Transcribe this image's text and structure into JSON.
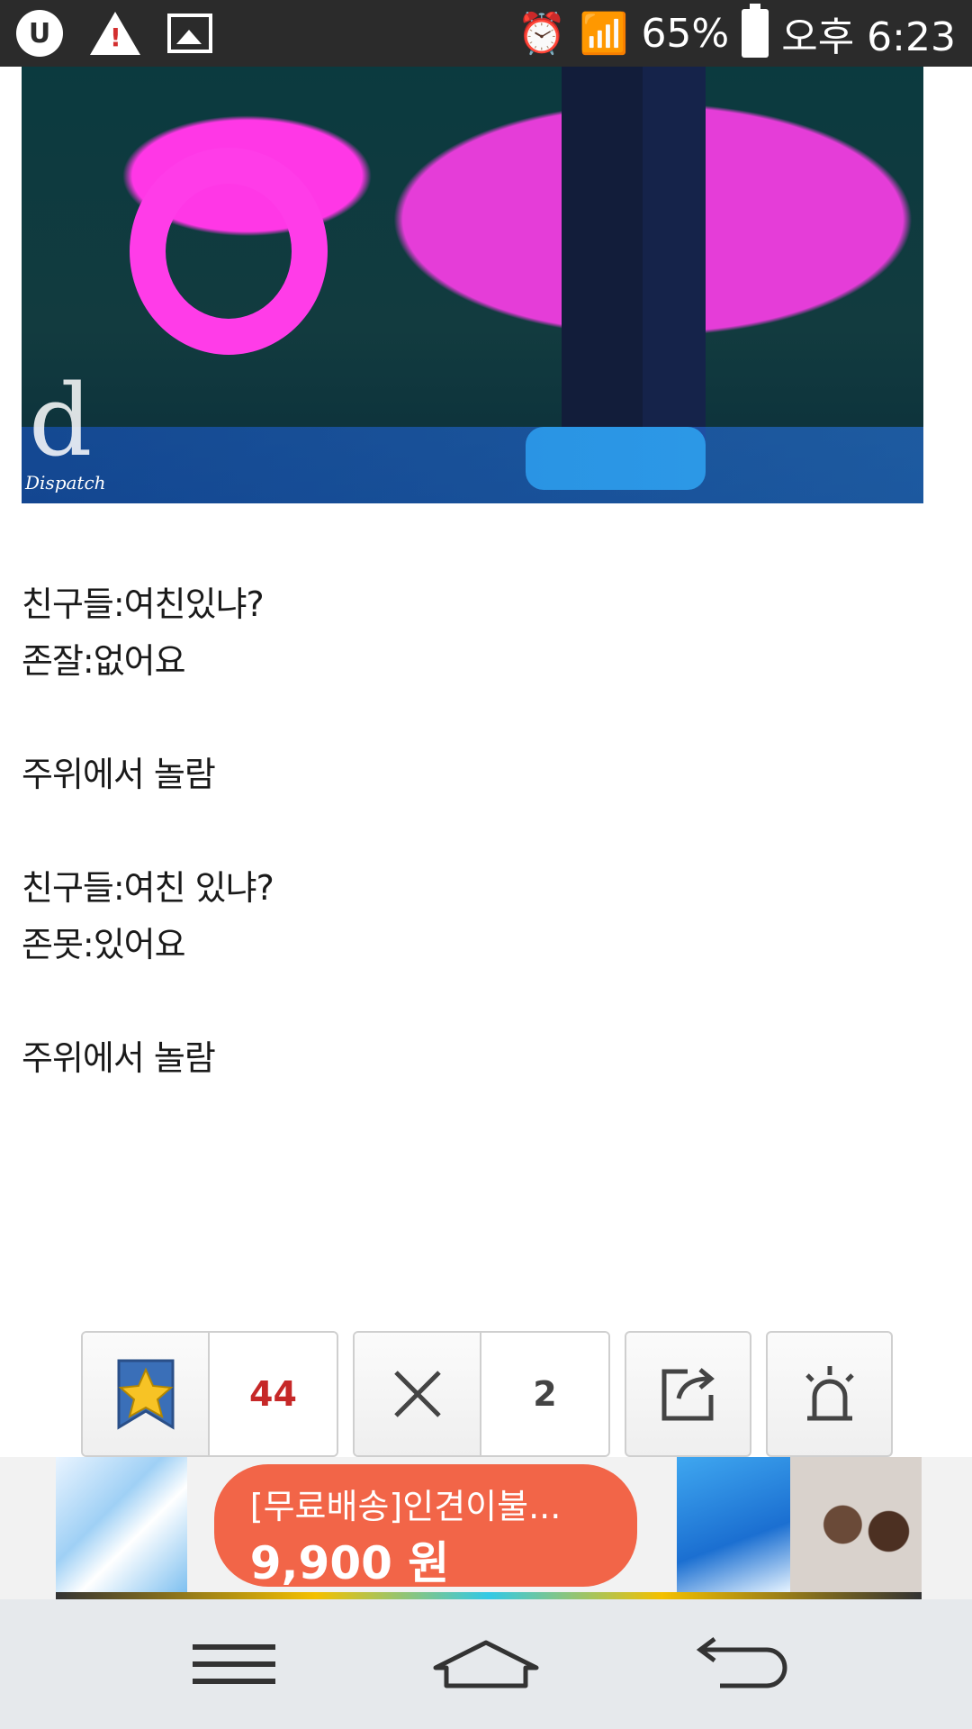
{
  "status_bar": {
    "battery_percent": "65%",
    "time": "오후 6:23"
  },
  "image": {
    "watermark": "d",
    "watermark_sub": "Dispatch"
  },
  "article": {
    "lines": [
      "친구들:여친있냐?",
      "존잘:없어요",
      "",
      "주위에서 놀람",
      "",
      "친구들:여친 있냐?",
      "존못:있어요",
      "",
      "주위에서 놀람"
    ]
  },
  "actions": {
    "like_count": "44",
    "dislike_count": "2"
  },
  "ad": {
    "title": "[무료배송]인견이불...",
    "price": "9,900 원"
  }
}
